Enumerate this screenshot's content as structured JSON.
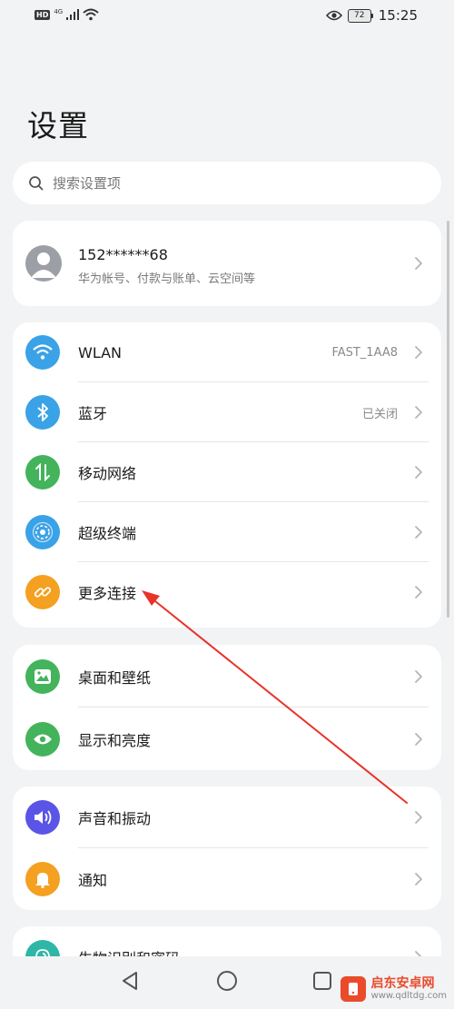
{
  "status_bar": {
    "hd": "HD",
    "network": "4G",
    "battery": "72",
    "time": "15:25"
  },
  "page": {
    "title": "设置"
  },
  "search": {
    "placeholder": "搜索设置项"
  },
  "account": {
    "name": "152******68",
    "subtitle": "华为帐号、付款与账单、云空间等"
  },
  "connectivity": [
    {
      "label": "WLAN",
      "value": "FAST_1AA8",
      "icon": "wifi-icon",
      "color": "#3aa2e6"
    },
    {
      "label": "蓝牙",
      "value": "已关闭",
      "icon": "bluetooth-icon",
      "color": "#3aa2e6"
    },
    {
      "label": "移动网络",
      "value": "",
      "icon": "mobile-data-icon",
      "color": "#43b35c"
    },
    {
      "label": "超级终端",
      "value": "",
      "icon": "super-device-icon",
      "color": "#3aa2e6"
    },
    {
      "label": "更多连接",
      "value": "",
      "icon": "link-icon",
      "color": "#f4a020"
    }
  ],
  "display": [
    {
      "label": "桌面和壁纸",
      "icon": "wallpaper-icon",
      "color": "#43b35c"
    },
    {
      "label": "显示和亮度",
      "icon": "eye-icon",
      "color": "#43b35c"
    }
  ],
  "sound": [
    {
      "label": "声音和振动",
      "icon": "speaker-icon",
      "color": "#5a55e6"
    },
    {
      "label": "通知",
      "icon": "bell-icon",
      "color": "#f4a020"
    }
  ],
  "partial": [
    {
      "label": "生物识别和密码",
      "icon": "fingerprint-icon",
      "color": "#2fb6a7"
    }
  ],
  "watermark": {
    "title": "启东安卓网",
    "url": "www.qdltdg.com"
  },
  "colors": {
    "annotation_arrow": "#e8322a"
  }
}
